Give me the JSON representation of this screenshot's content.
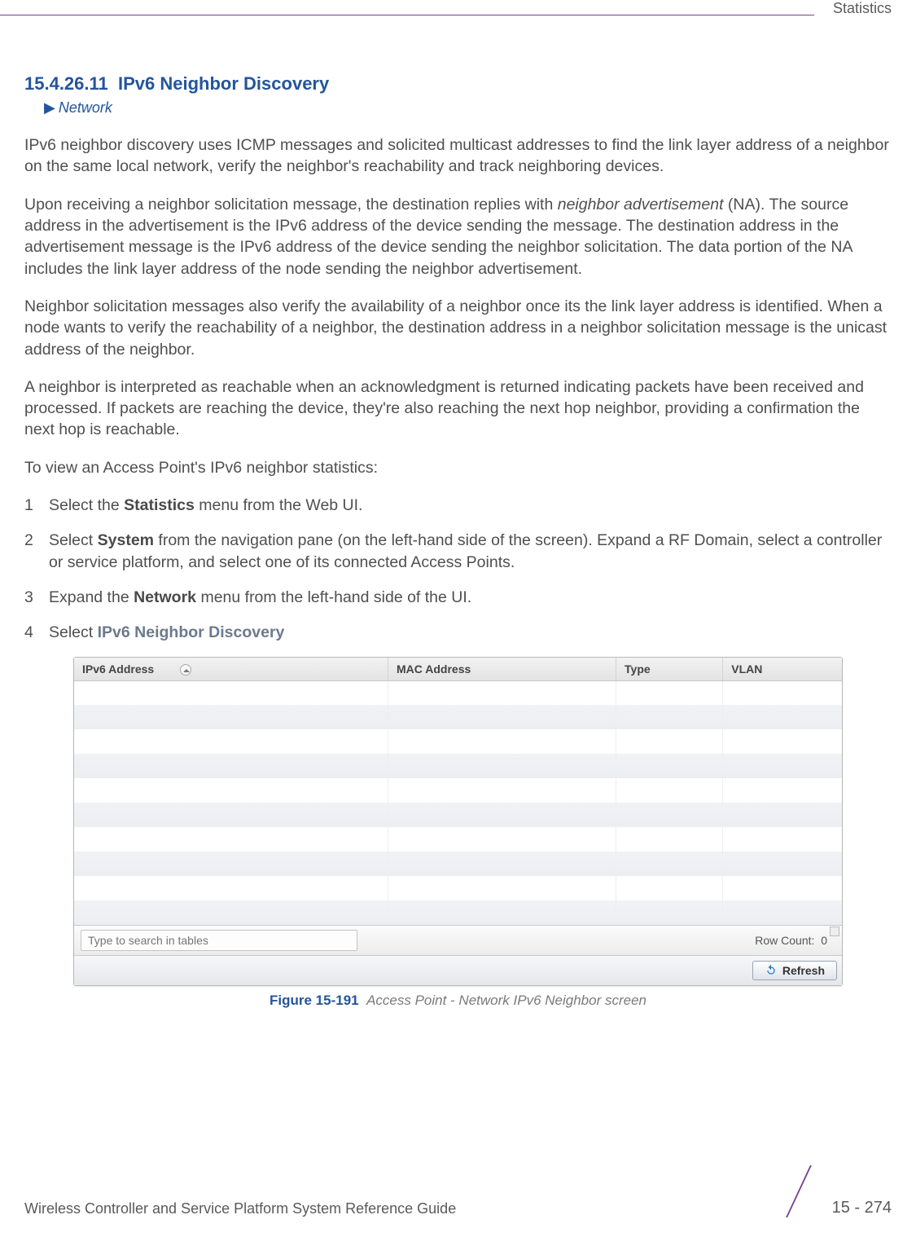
{
  "header": {
    "section": "Statistics"
  },
  "heading": {
    "number": "15.4.26.11",
    "title": "IPv6 Neighbor Discovery"
  },
  "breadcrumb": {
    "arrow": "▶",
    "label": "Network"
  },
  "paragraphs": {
    "p1": "IPv6 neighbor discovery uses ICMP messages and solicited multicast addresses to find the link layer address of a neighbor on the same local network, verify the neighbor's reachability and track neighboring devices.",
    "p2a": "Upon receiving a neighbor solicitation message, the destination replies with ",
    "p2em": "neighbor advertisement",
    "p2b": " (NA). The source address in the advertisement is the IPv6 address of the device sending the message. The destination address in the advertisement message is the IPv6 address of the device sending the neighbor solicitation. The data portion of the NA includes the link layer address of the node sending the neighbor advertisement.",
    "p3": "Neighbor solicitation messages also verify the availability of a neighbor once its the link layer address is identified. When a node wants to verify the reachability of a neighbor, the destination address in a neighbor solicitation message is the unicast address of the neighbor.",
    "p4": "A neighbor is interpreted as reachable when an acknowledgment is returned indicating packets have been received and processed. If packets are reaching the device, they're also reaching the next hop neighbor, providing a confirmation the next hop is reachable.",
    "p5": "To view an Access Point's IPv6 neighbor statistics:"
  },
  "steps": [
    {
      "n": "1",
      "pre": "Select the ",
      "bold": "Statistics",
      "post": " menu from the Web UI."
    },
    {
      "n": "2",
      "pre": "Select ",
      "bold": "System",
      "post": " from the navigation pane (on the left-hand side of the screen). Expand a RF Domain, select a controller or service platform, and select one of its connected Access Points."
    },
    {
      "n": "3",
      "pre": "Expand the ",
      "bold": "Network",
      "post": " menu from the left-hand side of the UI."
    },
    {
      "n": "4",
      "pre": "Select ",
      "bold_blue": "IPv6 Neighbor Discovery",
      "post": ""
    }
  ],
  "table": {
    "columns": [
      "IPv6 Address",
      "MAC Address",
      "Type",
      "VLAN"
    ],
    "search_placeholder": "Type to search in tables",
    "rowcount_label": "Row Count:",
    "rowcount_value": "0",
    "refresh_label": "Refresh"
  },
  "caption": {
    "fig_label": "Figure 15-191",
    "fig_text": "Access Point - Network IPv6 Neighbor screen"
  },
  "footer": {
    "guide": "Wireless Controller and Service Platform System Reference Guide",
    "page": "15 - 274"
  }
}
